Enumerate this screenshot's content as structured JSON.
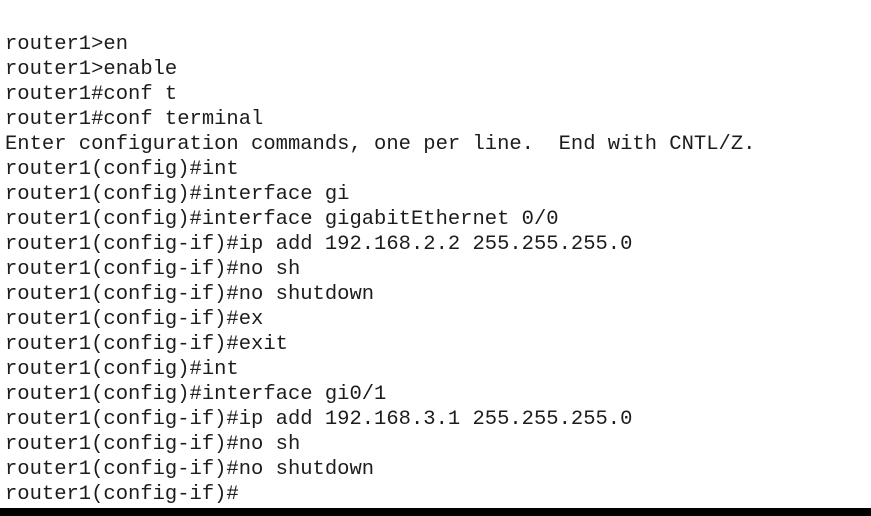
{
  "terminal": {
    "device_hostname": "router1",
    "prompt_user_mode": "router1>",
    "prompt_priv_mode": "router1#",
    "prompt_config_mode": "router1(config)#",
    "prompt_config_if_mode": "router1(config-if)#",
    "colors": {
      "background": "#ffffff",
      "text": "#1c1c1c",
      "bottom_border": "#000000"
    },
    "lines": [
      "router1>en",
      "router1>enable",
      "router1#conf t",
      "router1#conf terminal",
      "Enter configuration commands, one per line.  End with CNTL/Z.",
      "router1(config)#int",
      "router1(config)#interface gi",
      "router1(config)#interface gigabitEthernet 0/0",
      "router1(config-if)#ip add 192.168.2.2 255.255.255.0",
      "router1(config-if)#no sh",
      "router1(config-if)#no shutdown",
      "router1(config-if)#ex",
      "router1(config-if)#exit",
      "router1(config)#int",
      "router1(config)#interface gi0/1",
      "router1(config-if)#ip add 192.168.3.1 255.255.255.0",
      "router1(config-if)#no sh",
      "router1(config-if)#no shutdown",
      "router1(config-if)#"
    ],
    "line_count": 19,
    "interfaces_configured": [
      {
        "name": "gigabitEthernet 0/0",
        "ip_address": "192.168.2.2",
        "subnet_mask": "255.255.255.0",
        "state": "no shutdown"
      },
      {
        "name": "gi0/1",
        "ip_address": "192.168.3.1",
        "subnet_mask": "255.255.255.0",
        "state": "no shutdown"
      }
    ],
    "info_message": "Enter configuration commands, one per line.  End with CNTL/Z.",
    "cursor_line_index": 18
  }
}
